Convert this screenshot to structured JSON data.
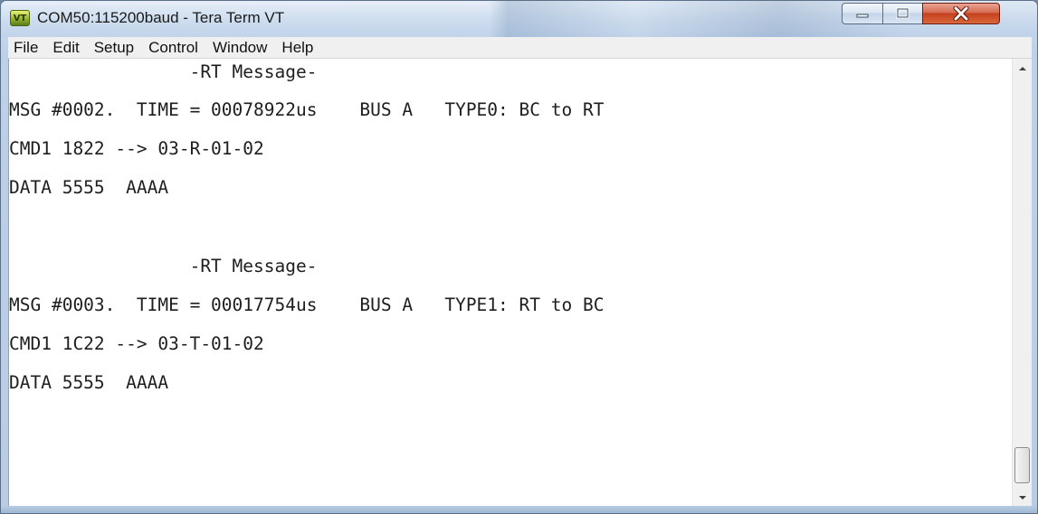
{
  "window": {
    "title": "COM50:115200baud - Tera Term VT",
    "icon_name": "tera-term-app-icon",
    "icon_text": "VT"
  },
  "menu": {
    "items": [
      {
        "label": "File"
      },
      {
        "label": "Edit"
      },
      {
        "label": "Setup"
      },
      {
        "label": "Control"
      },
      {
        "label": "Window"
      },
      {
        "label": "Help"
      }
    ]
  },
  "terminal": {
    "lines": [
      "                 -RT Message-",
      "MSG #0002.  TIME = 00078922us    BUS A   TYPE0: BC to RT",
      "CMD1 1822 --> 03-R-01-02",
      "DATA 5555  AAAA",
      "",
      "                 -RT Message-",
      "MSG #0003.  TIME = 00017754us    BUS A   TYPE1: RT to BC",
      "CMD1 1C22 --> 03-T-01-02",
      "DATA 5555  AAAA"
    ]
  },
  "colors": {
    "close_button": "#c4401f",
    "terminal_background": "#ffffff",
    "terminal_text": "#1e1e1e"
  }
}
